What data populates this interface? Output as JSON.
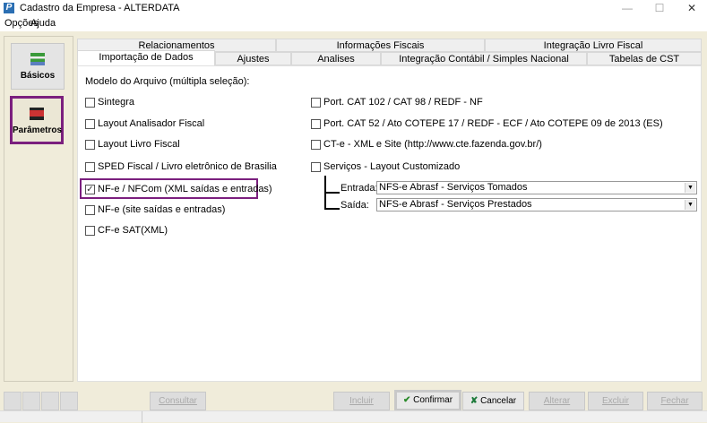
{
  "window": {
    "title": "Cadastro da Empresa - ALTERDATA",
    "minimize": "—",
    "maximize": "☐",
    "close": "✕"
  },
  "menu": [
    "Opções",
    "Ajuda"
  ],
  "sidebar": [
    {
      "label": "Básicos"
    },
    {
      "label": "Parâmetros"
    }
  ],
  "tabs_row1": [
    "Relacionamentos",
    "Informações Fiscais",
    "Integração Livro Fiscal"
  ],
  "tabs_row2": [
    "Importação de Dados",
    "Ajustes",
    "Analises",
    "Integração Contábil / Simples Nacional",
    "Tabelas de CST"
  ],
  "content": {
    "heading": "Modelo do Arquivo (múltipla seleção):",
    "left_options": [
      {
        "label": "Sintegra",
        "checked": false
      },
      {
        "label": "Layout Analisador Fiscal",
        "checked": false
      },
      {
        "label": "Layout Livro Fiscal",
        "checked": false
      },
      {
        "label": "SPED Fiscal / Livro eletrônico de Brasilia",
        "checked": false
      },
      {
        "label": "NF-e / NFCom (XML saídas e entradas)",
        "checked": true
      },
      {
        "label": "NF-e (site saídas e entradas)",
        "checked": false
      },
      {
        "label": "CF-e SAT(XML)",
        "checked": false
      }
    ],
    "right_options": [
      {
        "label": "Port. CAT 102 / CAT 98 / REDF - NF",
        "checked": false
      },
      {
        "label": "Port. CAT 52 / Ato COTEPE 17 / REDF - ECF / Ato COTEPE 09 de 2013 (ES)",
        "checked": false
      },
      {
        "label": "CT-e - XML e Site (http://www.cte.fazenda.gov.br/)",
        "checked": false
      },
      {
        "label": "Serviços - Layout Customizado",
        "checked": false
      }
    ],
    "entrada_label": "Entrada:",
    "entrada_value": "NFS-e Abrasf - Serviços Tomados",
    "saida_label": "Saída:",
    "saida_value": "NFS-e Abrasf - Serviços Prestados"
  },
  "buttons": {
    "consultar": "Consultar",
    "incluir": "Incluir",
    "confirmar": "Confirmar",
    "cancelar": "Cancelar",
    "alterar": "Alterar",
    "excluir": "Excluir",
    "fechar": "Fechar"
  },
  "colors": {
    "highlight": "#7b1f7e",
    "background": "#f0ecda"
  }
}
